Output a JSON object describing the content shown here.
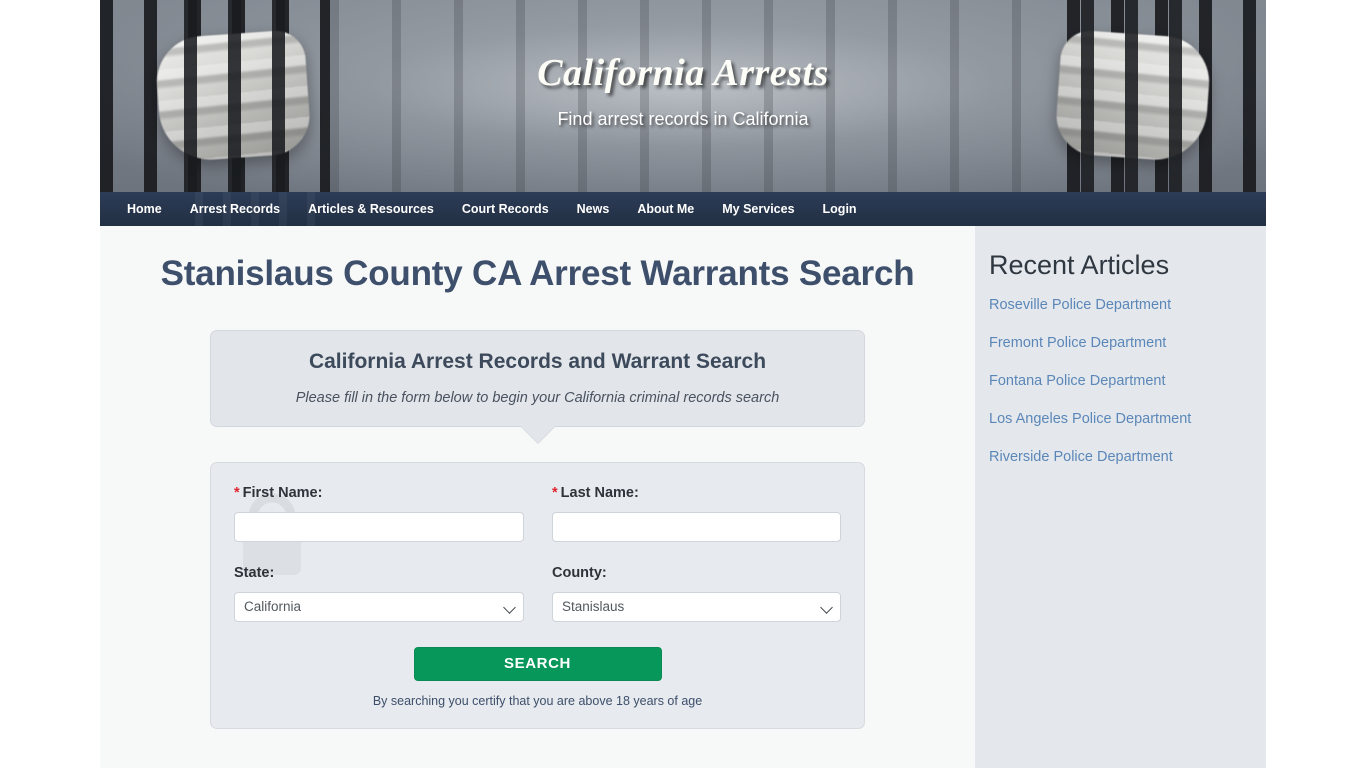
{
  "site": {
    "title": "California Arrests",
    "tagline": "Find arrest records in California"
  },
  "nav": {
    "items": [
      {
        "label": "Home",
        "name": "home"
      },
      {
        "label": "Arrest Records",
        "name": "arrest-records"
      },
      {
        "label": "Articles & Resources",
        "name": "articles-resources"
      },
      {
        "label": "Court Records",
        "name": "court-records"
      },
      {
        "label": "News",
        "name": "news"
      },
      {
        "label": "About Me",
        "name": "about-me"
      },
      {
        "label": "My Services",
        "name": "my-services"
      },
      {
        "label": "Login",
        "name": "login"
      }
    ]
  },
  "main": {
    "page_title": "Stanislaus County CA Arrest Warrants Search",
    "callout": {
      "title": "California Arrest Records and Warrant Search",
      "subtitle": "Please fill in the form below to begin your California criminal records search"
    },
    "form": {
      "first_name": {
        "label": "First Name:",
        "required_marker": "*",
        "value": "",
        "placeholder": ""
      },
      "last_name": {
        "label": "Last Name:",
        "required_marker": "*",
        "value": "",
        "placeholder": ""
      },
      "state": {
        "label": "State:",
        "selected": "California"
      },
      "county": {
        "label": "County:",
        "selected": "Stanislaus"
      },
      "submit_label": "SEARCH",
      "disclaimer": "By searching you certify that you are above 18 years of age"
    }
  },
  "sidebar": {
    "title": "Recent Articles",
    "links": [
      "Roseville Police Department",
      "Fremont Police Department",
      "Fontana Police Department",
      "Los Angeles Police Department",
      "Riverside Police Department"
    ]
  },
  "colors": {
    "nav_bg": "#27354c",
    "heading": "#3d4f6b",
    "search_button": "#07975a",
    "link": "#5b87b8",
    "sidebar_bg": "#e4e8ed",
    "required_asterisk": "#e0242b"
  }
}
